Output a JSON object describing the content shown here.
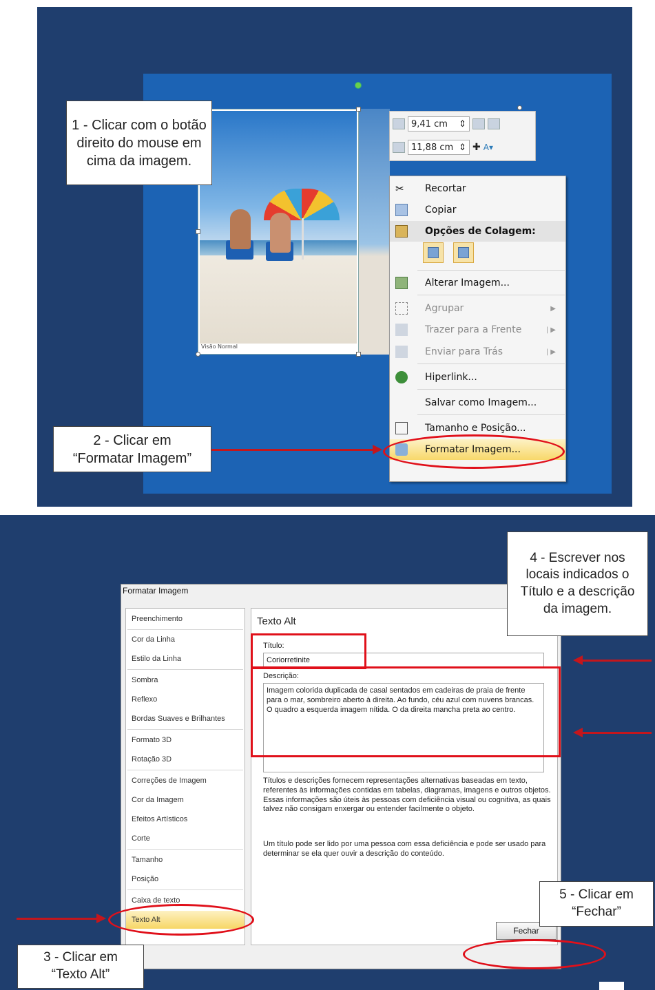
{
  "top": {
    "callout1": "1 - Clicar com o botão direito do mouse em cima da imagem.",
    "callout2_line1": "2 - Clicar em",
    "callout2_line2": "“Formatar Imagem”",
    "photo_caption": "Visão Normal",
    "mini_toolbar": {
      "height_value": "9,41 cm",
      "width_value": "11,88 cm"
    },
    "context_menu": {
      "items": [
        {
          "label": "Recortar",
          "icon": "scissors-icon"
        },
        {
          "label": "Copiar",
          "icon": "copy-icon"
        },
        {
          "label": "Opções de Colagem:",
          "icon": "paste-icon"
        },
        {
          "label": "Alterar Imagem...",
          "icon": "change-picture-icon"
        },
        {
          "label": "Agrupar",
          "icon": "group-icon"
        },
        {
          "label": "Trazer para a Frente",
          "icon": "bring-forward-icon"
        },
        {
          "label": "Enviar para Trás",
          "icon": "send-backward-icon"
        },
        {
          "label": "Hiperlink...",
          "icon": "hyperlink-icon"
        },
        {
          "label": "Salvar como Imagem...",
          "icon": "save-picture-icon"
        },
        {
          "label": "Tamanho e Posição...",
          "icon": "size-position-icon"
        },
        {
          "label": "Formatar Imagem...",
          "icon": "format-picture-icon"
        }
      ]
    }
  },
  "bottom": {
    "callout3_line1": "3 - Clicar em",
    "callout3_line2": "“Texto Alt”",
    "callout4": "4 - Escrever nos locais indicados o Título e a descrição da imagem.",
    "callout5_line1": "5 - Clicar em",
    "callout5_line2": "“Fechar”",
    "dialog": {
      "title": "Formatar Imagem",
      "nav": [
        "Preenchimento",
        "Cor da Linha",
        "Estilo da Linha",
        "Sombra",
        "Reflexo",
        "Bordas Suaves e Brilhantes",
        "Formato 3D",
        "Rotação 3D",
        "Correções de Imagem",
        "Cor da Imagem",
        "Efeitos Artísticos",
        "Corte",
        "Tamanho",
        "Posição",
        "Caixa de texto",
        "Texto Alt"
      ],
      "content_title": "Texto Alt",
      "title_label": "Título:",
      "title_value": "Coriorretinite",
      "desc_label": "Descrição:",
      "desc_value": "Imagem colorida duplicada de casal sentados em cadeiras de praia de frente para o mar,  sombreiro aberto à direita. Ao fundo, céu azul com nuvens brancas. O quadro a esquerda imagem nítida. O da direita mancha preta ao centro.",
      "help1": "Títulos e descrições fornecem representações alternativas baseadas em texto, referentes às informações contidas em tabelas, diagramas, imagens e outros objetos. Essas informações são úteis às pessoas com deficiência visual ou cognitiva, as quais talvez não consigam enxergar ou entender facilmente o objeto.",
      "help2": "Um título pode ser lido por uma pessoa com essa deficiência e pode ser usado para determinar se ela quer ouvir a descrição do conteúdo.",
      "close_label": "Fechar"
    }
  },
  "colors": {
    "background_navy": "#1f3e6e",
    "slide_blue": "#1c63b4",
    "highlight_red": "#e0101a",
    "selection_gold": "#f7d766"
  }
}
